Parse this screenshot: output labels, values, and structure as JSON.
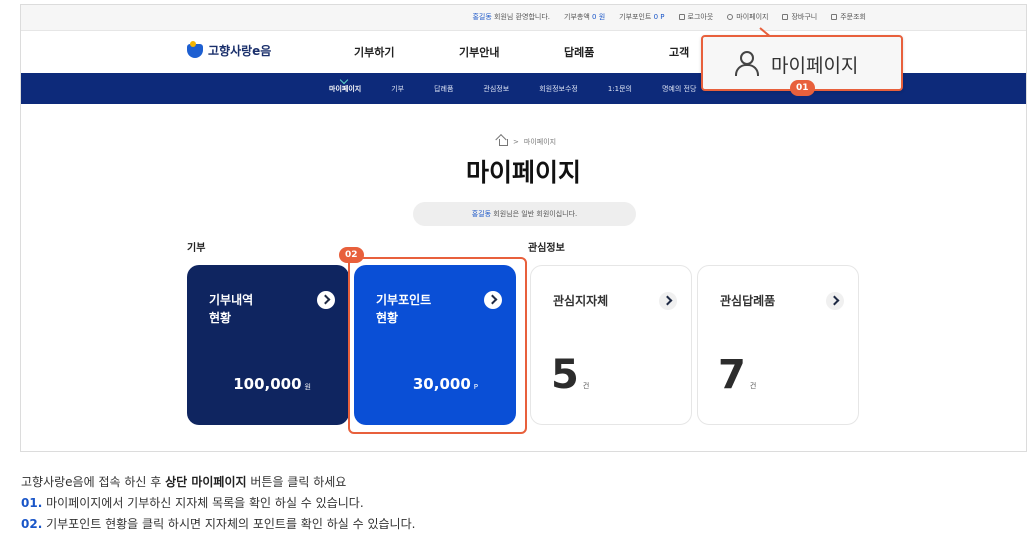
{
  "util_bar": {
    "user_name": "홍길동",
    "welcome": "회원님 환영합니다.",
    "donation_label": "기부총액",
    "donation_value": "0 원",
    "points_label": "기부포인트",
    "points_value": "0 P",
    "logout": "로그아웃",
    "mypage": "마이페이지",
    "cart": "장바구니",
    "orders": "주문조회"
  },
  "header": {
    "logo": "고향사랑e음",
    "nav": [
      "기부하기",
      "기부안내",
      "답례품",
      "고객"
    ]
  },
  "subnav": {
    "items": [
      "마이페이지",
      "기부",
      "답례품",
      "관심정보",
      "회원정보수정",
      "1:1문의",
      "명예의 전당"
    ]
  },
  "breadcrumb": {
    "current": "마이페이지"
  },
  "page_title": "마이페이지",
  "greeting": {
    "name": "홍길동",
    "text": "회원님은 일반 회원이십니다."
  },
  "sections": {
    "donation": "기부",
    "interest": "관심정보"
  },
  "cards": {
    "history": {
      "title": "기부내역\n현황",
      "amount": "100,000",
      "unit": "원"
    },
    "points": {
      "title": "기부포인트\n현황",
      "amount": "30,000",
      "unit": "P"
    },
    "regions": {
      "title": "관심지자체",
      "count": "5",
      "unit": "건"
    },
    "gifts": {
      "title": "관심답례품",
      "count": "7",
      "unit": "건"
    }
  },
  "callouts": {
    "badge1": "01",
    "badge2": "02",
    "popout_label": "마이페이지",
    "color": "#e8603c"
  },
  "guide": {
    "intro_before": "고향사랑e음에 접속 하신 후 ",
    "intro_bold": "상단 마이페이지",
    "intro_after": " 버튼을 클릭 하세요",
    "step1_num": "01.",
    "step1_text": " 마이페이지에서 기부하신 지자체 목록을 확인 하실 수 있습니다.",
    "step2_num": "02.",
    "step2_text": " 기부포인트 현황을 클릭 하시면 지자체의 포인트를 확인 하실 수 있습니다."
  },
  "colors": {
    "navy": "#0d2a7a",
    "dark_card": "#0f2560",
    "blue_card": "#0a4fd6",
    "accent_blue": "#1a56c8"
  }
}
